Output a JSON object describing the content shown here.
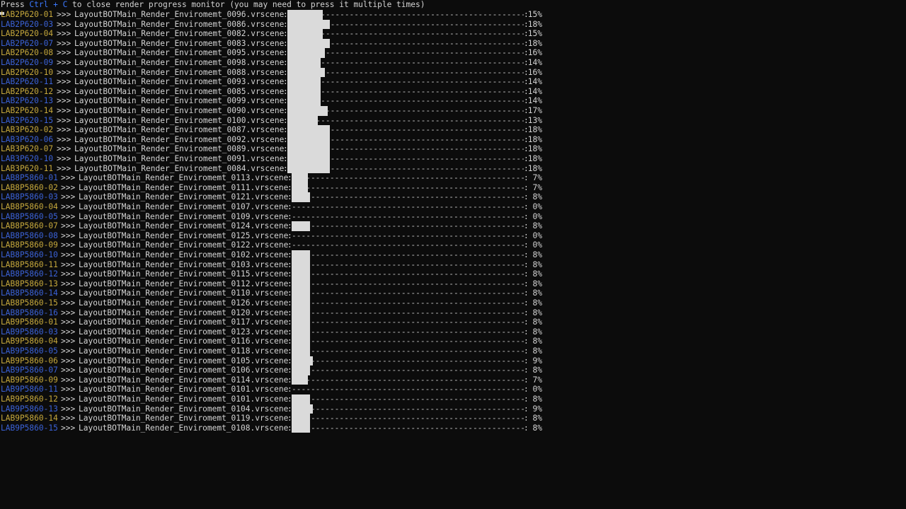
{
  "header": {
    "prefix": "Press ",
    "keys": "Ctrl + C",
    "suffix": " to close render progress monitor (you may need to press it multiple times)"
  },
  "colors": {
    "background": "#0c0c0c",
    "text": "#d4d4d4",
    "machine_yellow": "#c7a93c",
    "machine_blue": "#3b62d8",
    "bar_fill": "#dadada",
    "key_hint": "#3b78ff"
  },
  "rows": [
    {
      "machine": "LAB2P620-01",
      "color": "yellow",
      "scene": "LayoutBOTMain_Render_Enviromemt_0096.vrscene",
      "percent": "15%",
      "progress": 0.15
    },
    {
      "machine": "LAB2P620-03",
      "color": "blue",
      "scene": "LayoutBOTMain_Render_Enviromemt_0086.vrscene",
      "percent": "18%",
      "progress": 0.18
    },
    {
      "machine": "LAB2P620-04",
      "color": "yellow",
      "scene": "LayoutBOTMain_Render_Enviromemt_0082.vrscene",
      "percent": "15%",
      "progress": 0.15
    },
    {
      "machine": "LAB2P620-07",
      "color": "blue",
      "scene": "LayoutBOTMain_Render_Enviromemt_0083.vrscene",
      "percent": "18%",
      "progress": 0.18
    },
    {
      "machine": "LAB2P620-08",
      "color": "yellow",
      "scene": "LayoutBOTMain_Render_Enviromemt_0095.vrscene",
      "percent": "16%",
      "progress": 0.16
    },
    {
      "machine": "LAB2P620-09",
      "color": "blue",
      "scene": "LayoutBOTMain_Render_Enviromemt_0098.vrscene",
      "percent": "14%",
      "progress": 0.14
    },
    {
      "machine": "LAB2P620-10",
      "color": "yellow",
      "scene": "LayoutBOTMain_Render_Enviromemt_0088.vrscene",
      "percent": "16%",
      "progress": 0.16
    },
    {
      "machine": "LAB2P620-11",
      "color": "blue",
      "scene": "LayoutBOTMain_Render_Enviromemt_0093.vrscene",
      "percent": "14%",
      "progress": 0.14
    },
    {
      "machine": "LAB2P620-12",
      "color": "yellow",
      "scene": "LayoutBOTMain_Render_Enviromemt_0085.vrscene",
      "percent": "14%",
      "progress": 0.14
    },
    {
      "machine": "LAB2P620-13",
      "color": "blue",
      "scene": "LayoutBOTMain_Render_Enviromemt_0099.vrscene",
      "percent": "14%",
      "progress": 0.14
    },
    {
      "machine": "LAB2P620-14",
      "color": "yellow",
      "scene": "LayoutBOTMain_Render_Enviromemt_0090.vrscene",
      "percent": "17%",
      "progress": 0.17
    },
    {
      "machine": "LAB2P620-15",
      "color": "blue",
      "scene": "LayoutBOTMain_Render_Enviromemt_0100.vrscene",
      "percent": "13%",
      "progress": 0.13
    },
    {
      "machine": "LAB3P620-02",
      "color": "yellow",
      "scene": "LayoutBOTMain_Render_Enviromemt_0087.vrscene",
      "percent": "18%",
      "progress": 0.18
    },
    {
      "machine": "LAB3P620-06",
      "color": "blue",
      "scene": "LayoutBOTMain_Render_Enviromemt_0092.vrscene",
      "percent": "18%",
      "progress": 0.18
    },
    {
      "machine": "LAB3P620-07",
      "color": "yellow",
      "scene": "LayoutBOTMain_Render_Enviromemt_0089.vrscene",
      "percent": "18%",
      "progress": 0.18
    },
    {
      "machine": "LAB3P620-10",
      "color": "blue",
      "scene": "LayoutBOTMain_Render_Enviromemt_0091.vrscene",
      "percent": "18%",
      "progress": 0.18
    },
    {
      "machine": "LAB3P620-11",
      "color": "yellow",
      "scene": "LayoutBOTMain_Render_Enviromemt_0084.vrscene",
      "percent": "18%",
      "progress": 0.18
    },
    {
      "machine": "LAB8P5860-01",
      "color": "blue",
      "scene": "LayoutBOTMain_Render_Enviromemt_0113.vrscene",
      "percent": "7%",
      "progress": 0.07
    },
    {
      "machine": "LAB8P5860-02",
      "color": "yellow",
      "scene": "LayoutBOTMain_Render_Enviromemt_0111.vrscene",
      "percent": "7%",
      "progress": 0.07
    },
    {
      "machine": "LAB8P5860-03",
      "color": "blue",
      "scene": "LayoutBOTMain_Render_Enviromemt_0121.vrscene",
      "percent": "8%",
      "progress": 0.08
    },
    {
      "machine": "LAB8P5860-04",
      "color": "yellow",
      "scene": "LayoutBOTMain_Render_Enviromemt_0107.vrscene",
      "percent": "0%",
      "progress": 0.0
    },
    {
      "machine": "LAB8P5860-05",
      "color": "blue",
      "scene": "LayoutBOTMain_Render_Enviromemt_0109.vrscene",
      "percent": "0%",
      "progress": 0.0
    },
    {
      "machine": "LAB8P5860-07",
      "color": "yellow",
      "scene": "LayoutBOTMain_Render_Enviromemt_0124.vrscene",
      "percent": "8%",
      "progress": 0.08
    },
    {
      "machine": "LAB8P5860-08",
      "color": "blue",
      "scene": "LayoutBOTMain_Render_Enviromemt_0125.vrscene",
      "percent": "0%",
      "progress": 0.0
    },
    {
      "machine": "LAB8P5860-09",
      "color": "yellow",
      "scene": "LayoutBOTMain_Render_Enviromemt_0122.vrscene",
      "percent": "0%",
      "progress": 0.0
    },
    {
      "machine": "LAB8P5860-10",
      "color": "blue",
      "scene": "LayoutBOTMain_Render_Enviromemt_0102.vrscene",
      "percent": "8%",
      "progress": 0.08
    },
    {
      "machine": "LAB8P5860-11",
      "color": "yellow",
      "scene": "LayoutBOTMain_Render_Enviromemt_0103.vrscene",
      "percent": "8%",
      "progress": 0.08
    },
    {
      "machine": "LAB8P5860-12",
      "color": "blue",
      "scene": "LayoutBOTMain_Render_Enviromemt_0115.vrscene",
      "percent": "8%",
      "progress": 0.08
    },
    {
      "machine": "LAB8P5860-13",
      "color": "yellow",
      "scene": "LayoutBOTMain_Render_Enviromemt_0112.vrscene",
      "percent": "8%",
      "progress": 0.08
    },
    {
      "machine": "LAB8P5860-14",
      "color": "blue",
      "scene": "LayoutBOTMain_Render_Enviromemt_0110.vrscene",
      "percent": "8%",
      "progress": 0.08
    },
    {
      "machine": "LAB8P5860-15",
      "color": "yellow",
      "scene": "LayoutBOTMain_Render_Enviromemt_0126.vrscene",
      "percent": "8%",
      "progress": 0.08
    },
    {
      "machine": "LAB8P5860-16",
      "color": "blue",
      "scene": "LayoutBOTMain_Render_Enviromemt_0120.vrscene",
      "percent": "8%",
      "progress": 0.08
    },
    {
      "machine": "LAB9P5860-01",
      "color": "yellow",
      "scene": "LayoutBOTMain_Render_Enviromemt_0117.vrscene",
      "percent": "8%",
      "progress": 0.08
    },
    {
      "machine": "LAB9P5860-03",
      "color": "blue",
      "scene": "LayoutBOTMain_Render_Enviromemt_0123.vrscene",
      "percent": "8%",
      "progress": 0.08
    },
    {
      "machine": "LAB9P5860-04",
      "color": "yellow",
      "scene": "LayoutBOTMain_Render_Enviromemt_0116.vrscene",
      "percent": "8%",
      "progress": 0.08
    },
    {
      "machine": "LAB9P5860-05",
      "color": "blue",
      "scene": "LayoutBOTMain_Render_Enviromemt_0118.vrscene",
      "percent": "8%",
      "progress": 0.08
    },
    {
      "machine": "LAB9P5860-06",
      "color": "yellow",
      "scene": "LayoutBOTMain_Render_Enviromemt_0105.vrscene",
      "percent": "9%",
      "progress": 0.09
    },
    {
      "machine": "LAB9P5860-07",
      "color": "blue",
      "scene": "LayoutBOTMain_Render_Enviromemt_0106.vrscene",
      "percent": "8%",
      "progress": 0.08
    },
    {
      "machine": "LAB9P5860-09",
      "color": "yellow",
      "scene": "LayoutBOTMain_Render_Enviromemt_0114.vrscene",
      "percent": "7%",
      "progress": 0.07
    },
    {
      "machine": "LAB9P5860-11",
      "color": "blue",
      "scene": "LayoutBOTMain_Render_Enviromemt_0101.vrscene",
      "percent": "0%",
      "progress": 0.0
    },
    {
      "machine": "LAB9P5860-12",
      "color": "yellow",
      "scene": "LayoutBOTMain_Render_Enviromemt_0101.vrscene",
      "percent": "8%",
      "progress": 0.08
    },
    {
      "machine": "LAB9P5860-13",
      "color": "blue",
      "scene": "LayoutBOTMain_Render_Enviromemt_0104.vrscene",
      "percent": "9%",
      "progress": 0.09
    },
    {
      "machine": "LAB9P5860-14",
      "color": "yellow",
      "scene": "LayoutBOTMain_Render_Enviromemt_0119.vrscene",
      "percent": "8%",
      "progress": 0.08
    },
    {
      "machine": "LAB9P5860-15",
      "color": "blue",
      "scene": "LayoutBOTMain_Render_Enviromemt_0108.vrscene",
      "percent": "8%",
      "progress": 0.08
    }
  ],
  "arrows": ">>>"
}
